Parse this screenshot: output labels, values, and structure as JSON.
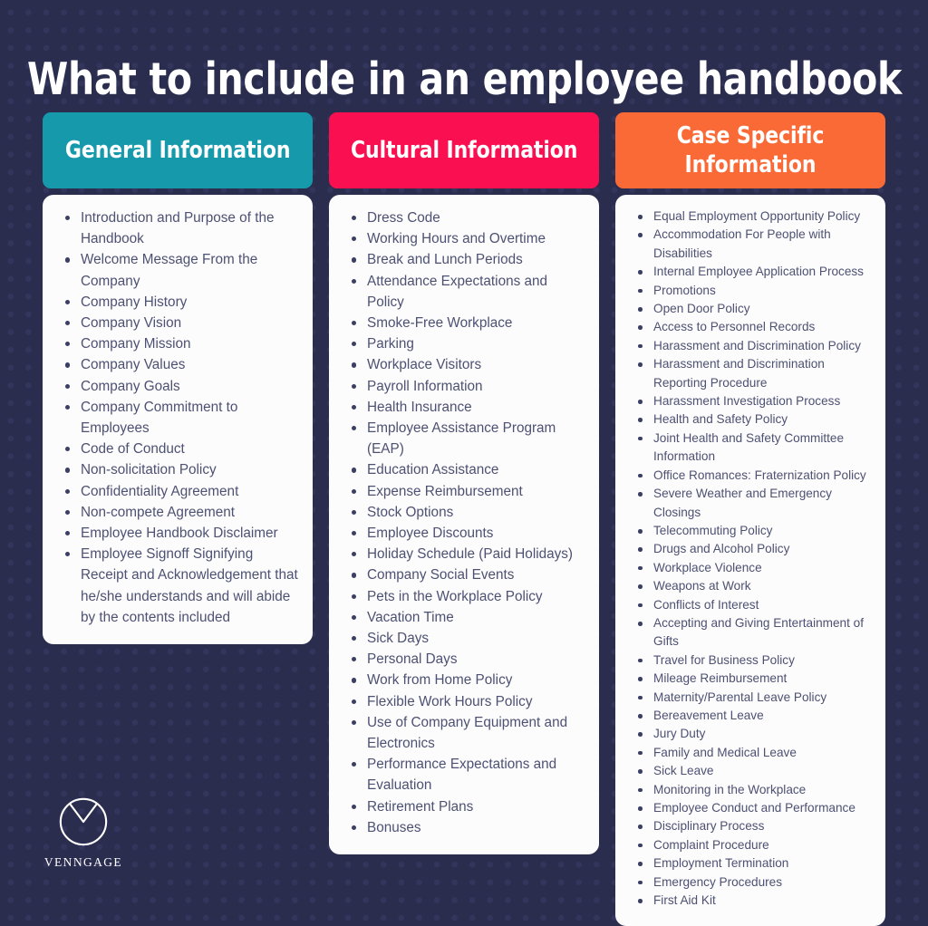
{
  "page": {
    "title": "What to include in an employee handbook",
    "background_color": "#2b2d4f",
    "dot_color": "#33355c"
  },
  "columns": [
    {
      "id": "general-information",
      "header": "General Information",
      "header_color": "#1799ac",
      "items": [
        "Introduction and Purpose of the Handbook",
        "Welcome Message From the Company",
        "Company History",
        "Company Vision",
        "Company Mission",
        "Company Values",
        "Company Goals",
        "Company Commitment to Employees",
        "Code of Conduct",
        "Non-solicitation Policy",
        "Confidentiality Agreement",
        "Non-compete Agreement",
        "Employee Handbook Disclaimer",
        "Employee Signoff Signifying Receipt and Acknowledgement that he/she understands and will abide by the contents included"
      ]
    },
    {
      "id": "cultural-information",
      "header": "Cultural Information",
      "header_color": "#fa0f50",
      "items": [
        "Dress Code",
        "Working Hours and Overtime",
        "Break and Lunch Periods",
        "Attendance Expectations and Policy",
        "Smoke-Free Workplace",
        "Parking",
        "Workplace Visitors",
        "Payroll Information",
        "Health Insurance",
        "Employee Assistance Program (EAP)",
        "Education Assistance",
        "Expense Reimbursement",
        "Stock Options",
        "Employee Discounts",
        "Holiday Schedule (Paid Holidays)",
        "Company Social Events",
        "Pets in the Workplace Policy",
        "Vacation Time",
        "Sick Days",
        "Personal Days",
        "Work from Home Policy",
        "Flexible Work Hours Policy",
        "Use of Company Equipment and Electronics",
        "Performance Expectations and Evaluation",
        "Retirement Plans",
        "Bonuses"
      ]
    },
    {
      "id": "case-specific-information",
      "header": "Case Specific Information",
      "header_color": "#fa6a37",
      "items": [
        "Equal Employment Opportunity Policy",
        "Accommodation For People with Disabilities",
        "Internal Employee Application Process",
        "Promotions",
        "Open Door Policy",
        "Access to Personnel Records",
        "Harassment and Discrimination Policy",
        "Harassment and Discrimination Reporting Procedure",
        "Harassment Investigation Process",
        "Health and Safety Policy",
        "Joint Health and Safety Committee Information",
        "Office Romances: Fraternization Policy",
        "Severe Weather and Emergency Closings",
        "Telecommuting Policy",
        "Drugs and Alcohol Policy",
        "Workplace Violence",
        "Weapons at Work",
        "Conflicts of Interest",
        "Accepting and Giving Entertainment of Gifts",
        "Travel for Business Policy",
        "Mileage Reimbursement",
        "Maternity/Parental Leave Policy",
        "Bereavement Leave",
        "Jury Duty",
        "Family and Medical Leave",
        "Sick Leave",
        "Monitoring in the Workplace",
        "Employee Conduct and Performance",
        "Disciplinary Process",
        "Complaint Procedure",
        "Employment Termination",
        "Emergency Procedures",
        "First Aid Kit"
      ]
    }
  ],
  "logo": {
    "icon": "venngage-circle-chevron-icon",
    "wordmark": "VENNGAGE"
  }
}
